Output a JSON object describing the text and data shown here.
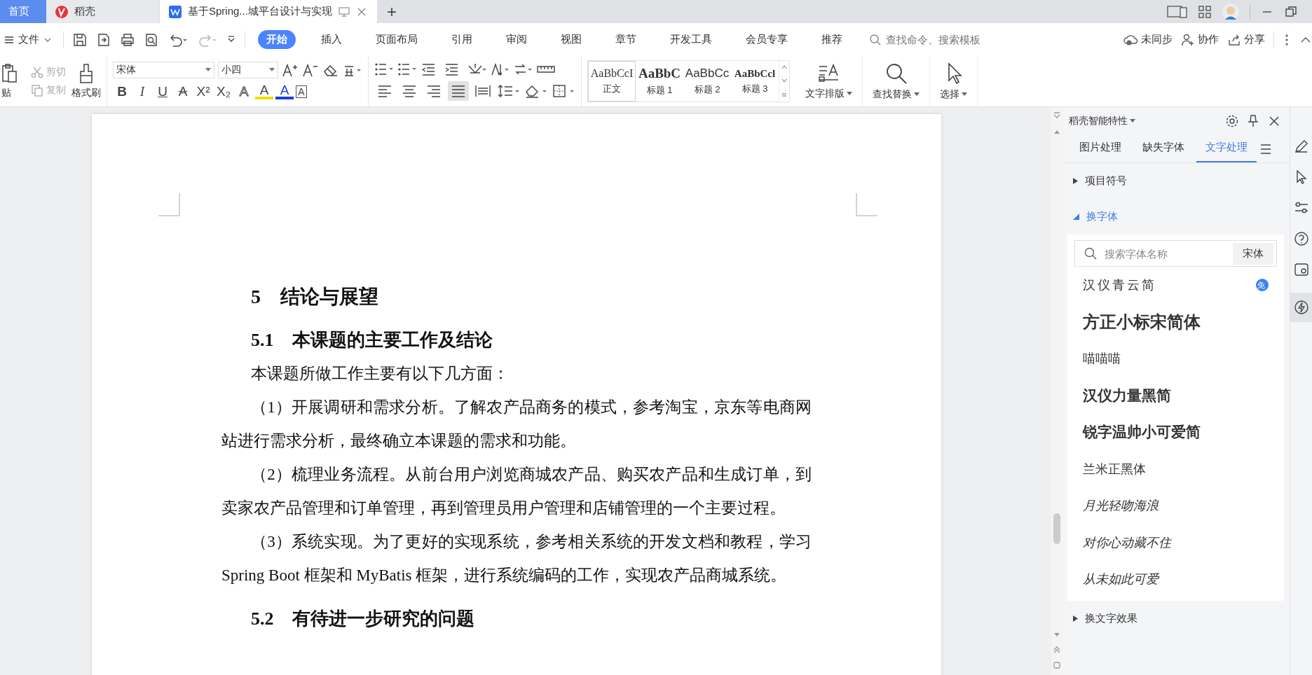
{
  "tabbar": {
    "tabs": [
      {
        "label": "首页",
        "kind": "home",
        "selected": false
      },
      {
        "label": "稻壳",
        "kind": "docer",
        "selected": false
      },
      {
        "label": "基于Spring...城平台设计与实现",
        "kind": "doc",
        "selected": true
      }
    ],
    "new_tab": "+"
  },
  "menubar": {
    "file_menu": "文件",
    "redo_disabled": true,
    "tabs": [
      {
        "label": "开始",
        "selected": true
      },
      {
        "label": "插入",
        "selected": false
      },
      {
        "label": "页面布局",
        "selected": false
      },
      {
        "label": "引用",
        "selected": false
      },
      {
        "label": "审阅",
        "selected": false
      },
      {
        "label": "视图",
        "selected": false
      },
      {
        "label": "章节",
        "selected": false
      },
      {
        "label": "开发工具",
        "selected": false
      },
      {
        "label": "会员专享",
        "selected": false
      },
      {
        "label": "推荐",
        "selected": false
      }
    ],
    "search": {
      "placeholder": "查找命令、搜索模板"
    },
    "actions": [
      {
        "label": "未同步",
        "kind": "cloud"
      },
      {
        "label": "协作",
        "kind": "person"
      },
      {
        "label": "分享",
        "kind": "share"
      }
    ]
  },
  "ribbon": {
    "clipboard": {
      "paste": "贴",
      "cut": {
        "label": "剪切",
        "disabled": true
      },
      "copy": {
        "label": "复制",
        "disabled": true
      },
      "format_painter": "格式刷"
    },
    "font": {
      "name": "宋体",
      "size": "小四",
      "format_buttons": [
        {
          "label": "B",
          "kind": "bold"
        },
        {
          "label": "I",
          "kind": "italic"
        },
        {
          "label": "U",
          "kind": "underline"
        },
        {
          "label": "A",
          "kind": "strike"
        },
        {
          "label": "X²",
          "kind": "plain"
        },
        {
          "label": "X₂",
          "kind": "plain"
        },
        {
          "label": "A",
          "kind": "outline"
        },
        {
          "label": "A",
          "kind": "highlight"
        },
        {
          "label": "A",
          "kind": "color"
        },
        {
          "label": "A",
          "kind": "boxed"
        }
      ]
    },
    "alignment": [
      {
        "selected": false
      },
      {
        "selected": false
      },
      {
        "selected": false
      },
      {
        "selected": true
      },
      {
        "selected": false
      }
    ],
    "styles": [
      {
        "preview": "AaBbCcI",
        "name": "正文",
        "kind": "body",
        "selected": true
      },
      {
        "preview": "AaBbC",
        "name": "标题 1",
        "kind": "h1",
        "selected": false
      },
      {
        "preview": "AaBbCc",
        "name": "标题 2",
        "kind": "h2",
        "selected": false
      },
      {
        "preview": "AaBbCcl",
        "name": "标题 3",
        "kind": "h3",
        "selected": false
      }
    ],
    "big_buttons": [
      {
        "label": "文字排版",
        "kind": "layout"
      },
      {
        "label": "查找替换",
        "kind": "find"
      },
      {
        "label": "选择",
        "kind": "select"
      }
    ]
  },
  "document": {
    "blocks": [
      {
        "kind": "h1",
        "number": "5",
        "text": "结论与展望"
      },
      {
        "kind": "h2",
        "number": "5.1",
        "text": "本课题的主要工作及结论"
      },
      {
        "kind": "p",
        "text": "本课题所做工作主要有以下几方面："
      },
      {
        "kind": "p",
        "text": "（1）开展调研和需求分析。了解农产品商务的模式，参考淘宝，京东等电商网站进行需求分析，最终确立本课题的需求和功能。"
      },
      {
        "kind": "p",
        "text": "（2）梳理业务流程。从前台用户浏览商城农产品、购买农产品和生成订单，到卖家农产品管理和订单管理，再到管理员用户管理和店铺管理的一个主要过程。"
      },
      {
        "kind": "p",
        "text": "（3）系统实现。为了更好的实现系统，参考相关系统的开发文档和教程，学习 Spring Boot 框架和 MyBatis 框架，进行系统编码的工作，实现农产品商城系统。"
      },
      {
        "kind": "h2",
        "number": "5.2",
        "text": "有待进一步研究的问题"
      }
    ]
  },
  "side_panel": {
    "title": "稻壳智能特性",
    "tabs": [
      {
        "label": "图片处理",
        "selected": false
      },
      {
        "label": "缺失字体",
        "selected": false
      },
      {
        "label": "文字处理",
        "selected": true
      }
    ],
    "sections_before": [
      {
        "label": "项目符号",
        "expanded": false
      }
    ],
    "font_section": {
      "label": "换字体",
      "expanded": true,
      "search": {
        "placeholder": "搜索字体名称"
      },
      "current_font": "宋体",
      "fonts": [
        {
          "name": "汉仪青云简",
          "badge": "免"
        },
        {
          "name": "方正小标宋简体"
        },
        {
          "name": "喵喵喵"
        },
        {
          "name": "汉仪力量黑简"
        },
        {
          "name": "锐字温帅小可爱简"
        },
        {
          "name": "兰米正黑体"
        },
        {
          "name": "月光轻吻海浪"
        },
        {
          "name": "对你心动藏不住"
        },
        {
          "name": "从未如此可爱"
        }
      ]
    },
    "sections_after": [
      {
        "label": "换文字效果",
        "expanded": false
      }
    ]
  }
}
